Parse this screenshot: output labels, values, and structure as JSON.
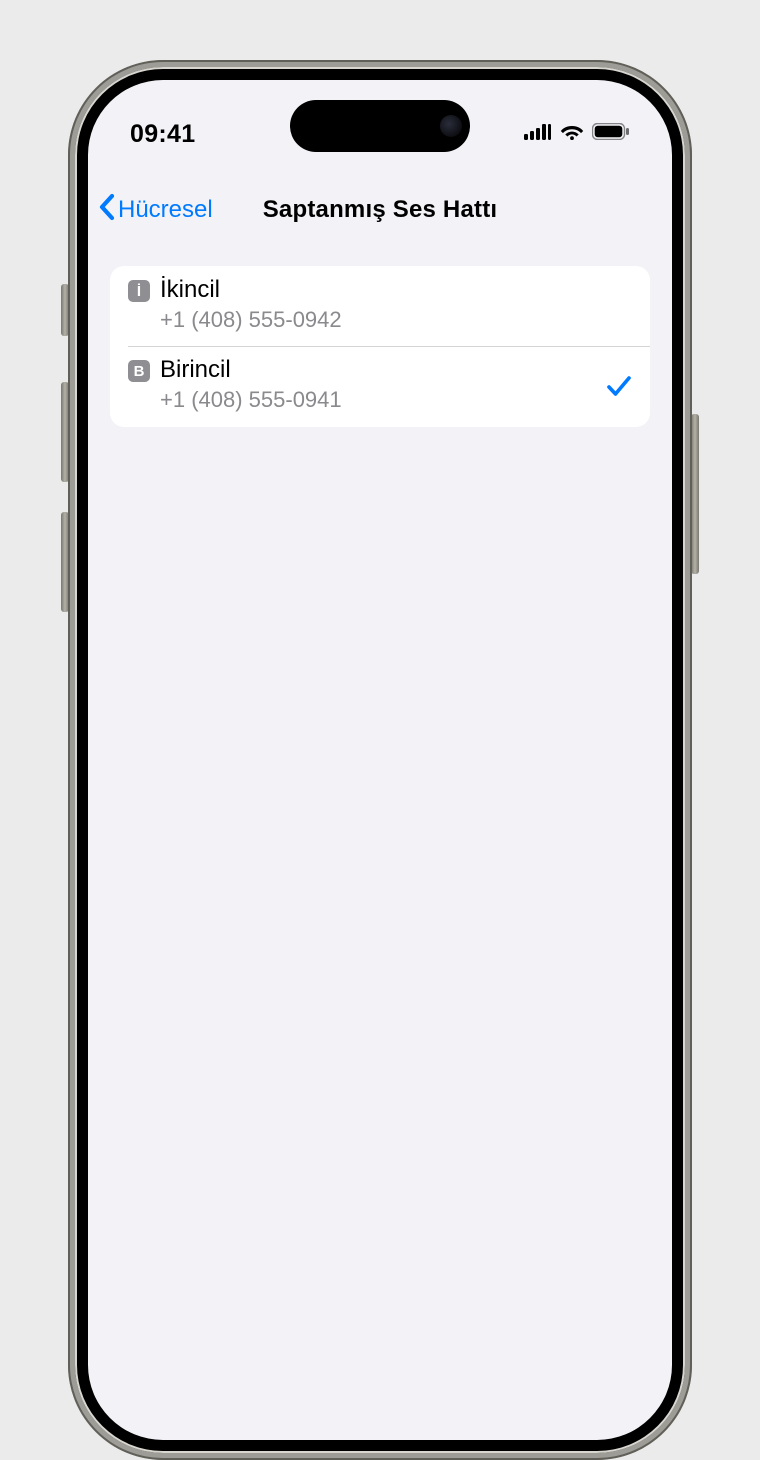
{
  "statusbar": {
    "time": "09:41"
  },
  "nav": {
    "back_label": "Hücresel",
    "title": "Saptanmış Ses Hattı"
  },
  "lines": [
    {
      "badge": "İ",
      "label": "İkincil",
      "number": "+1 (408) 555-0942",
      "selected": false
    },
    {
      "badge": "B",
      "label": "Birincil",
      "number": "+1 (408) 555-0941",
      "selected": true
    }
  ]
}
